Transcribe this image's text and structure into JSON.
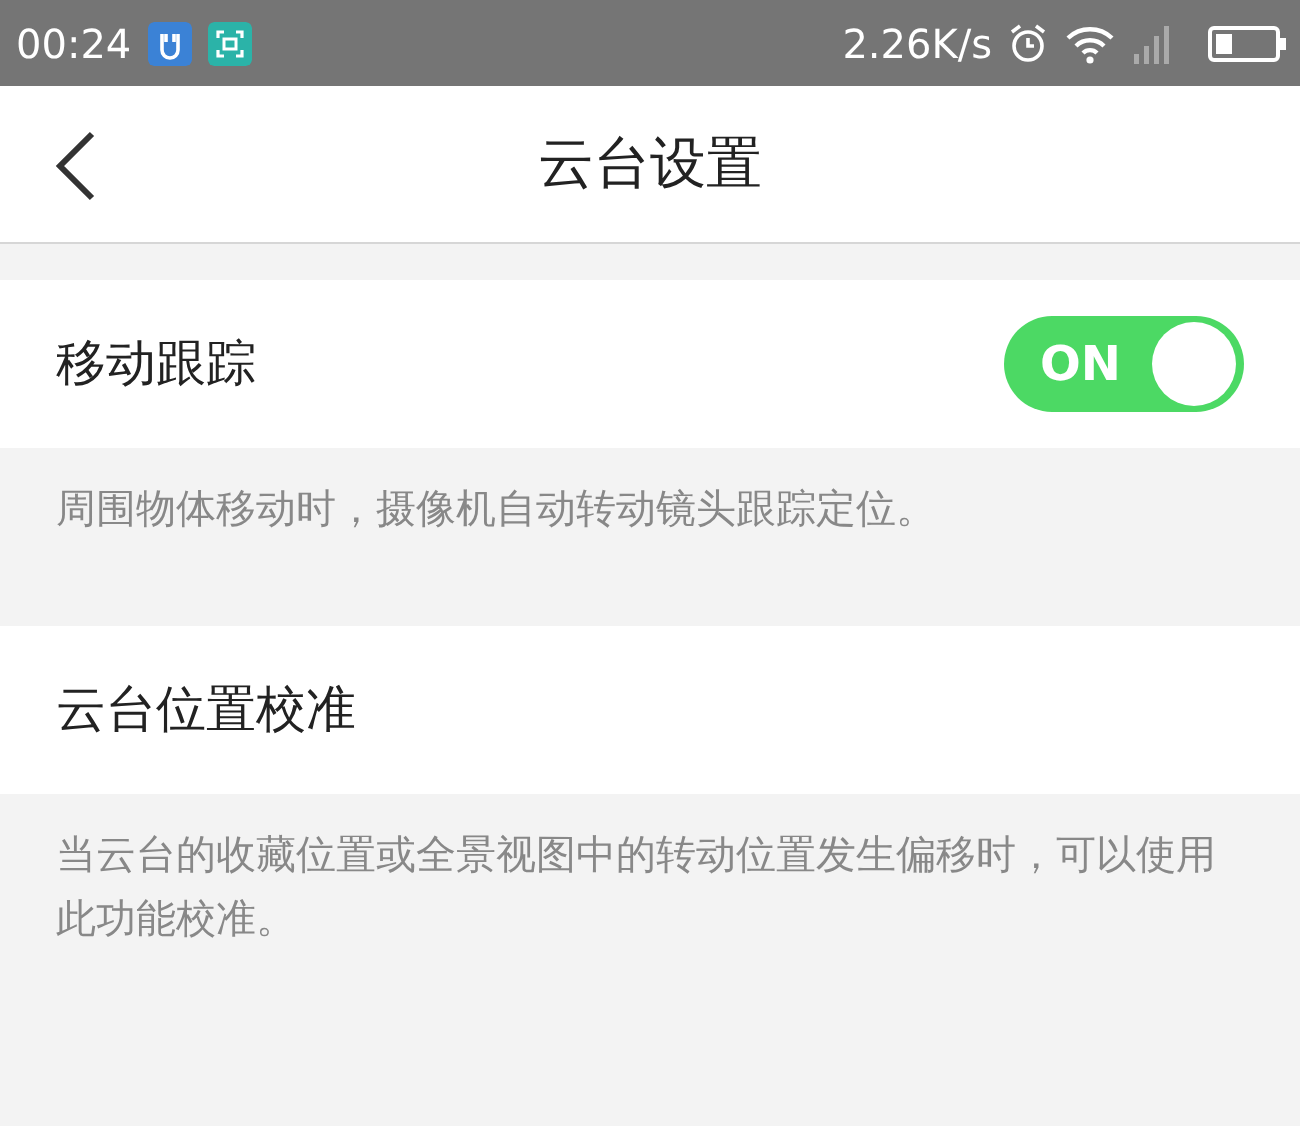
{
  "status_bar": {
    "time": "00:24",
    "speed": "2.26K/s"
  },
  "header": {
    "title": "云台设置"
  },
  "settings": [
    {
      "kind": "toggle",
      "label": "移动跟踪",
      "on": true,
      "switch_text": "ON",
      "description": "周围物体移动时，摄像机自动转动镜头跟踪定位。"
    },
    {
      "kind": "plain",
      "label": "云台位置校准",
      "description": "当云台的收藏位置或全景视图中的转动位置发生偏移时，可以使用此功能校准。"
    }
  ]
}
